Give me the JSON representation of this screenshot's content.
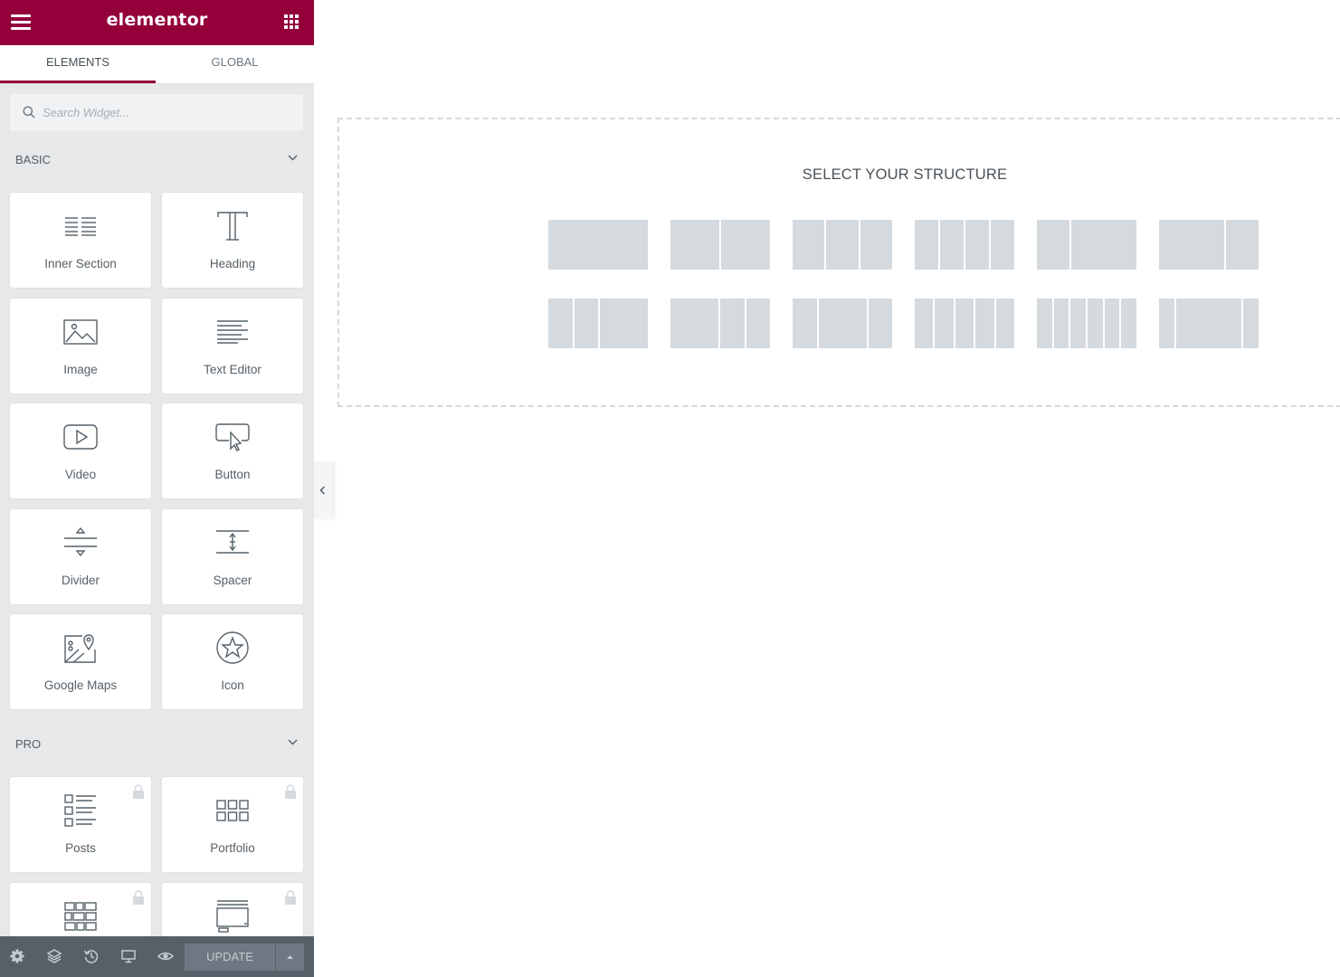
{
  "header": {
    "brand": "elementor",
    "brand_color": "#93003a"
  },
  "tabs": [
    {
      "label": "ELEMENTS",
      "active": true
    },
    {
      "label": "GLOBAL",
      "active": false
    }
  ],
  "search": {
    "placeholder": "Search Widget...",
    "value": ""
  },
  "categories": {
    "basic": {
      "title": "BASIC",
      "widgets": [
        {
          "label": "Inner Section",
          "icon": "inner-section-icon"
        },
        {
          "label": "Heading",
          "icon": "heading-icon"
        },
        {
          "label": "Image",
          "icon": "image-icon"
        },
        {
          "label": "Text Editor",
          "icon": "text-editor-icon"
        },
        {
          "label": "Video",
          "icon": "video-icon"
        },
        {
          "label": "Button",
          "icon": "button-icon"
        },
        {
          "label": "Divider",
          "icon": "divider-icon"
        },
        {
          "label": "Spacer",
          "icon": "spacer-icon"
        },
        {
          "label": "Google Maps",
          "icon": "google-maps-icon"
        },
        {
          "label": "Icon",
          "icon": "star-icon"
        }
      ]
    },
    "pro": {
      "title": "PRO",
      "widgets": [
        {
          "label": "Posts",
          "icon": "posts-icon",
          "locked": true
        },
        {
          "label": "Portfolio",
          "icon": "portfolio-icon",
          "locked": true
        },
        {
          "label": "",
          "icon": "gallery-icon",
          "locked": true
        },
        {
          "label": "",
          "icon": "slides-icon",
          "locked": true
        }
      ]
    }
  },
  "footer": {
    "update_label": "UPDATE",
    "icons": [
      "settings-icon",
      "navigator-icon",
      "history-icon",
      "responsive-icon",
      "preview-icon"
    ]
  },
  "canvas": {
    "title": "SELECT YOUR STRUCTURE",
    "presets": [
      [
        100
      ],
      [
        50,
        50
      ],
      [
        33,
        33,
        33
      ],
      [
        25,
        25,
        25,
        25
      ],
      [
        33,
        66
      ],
      [
        66,
        33
      ],
      [
        25,
        25,
        50
      ],
      [
        50,
        25,
        25
      ],
      [
        25,
        50,
        25
      ],
      [
        20,
        20,
        20,
        20,
        20
      ],
      [
        16,
        16,
        16,
        16,
        16,
        16
      ],
      [
        16,
        66,
        16
      ]
    ]
  }
}
